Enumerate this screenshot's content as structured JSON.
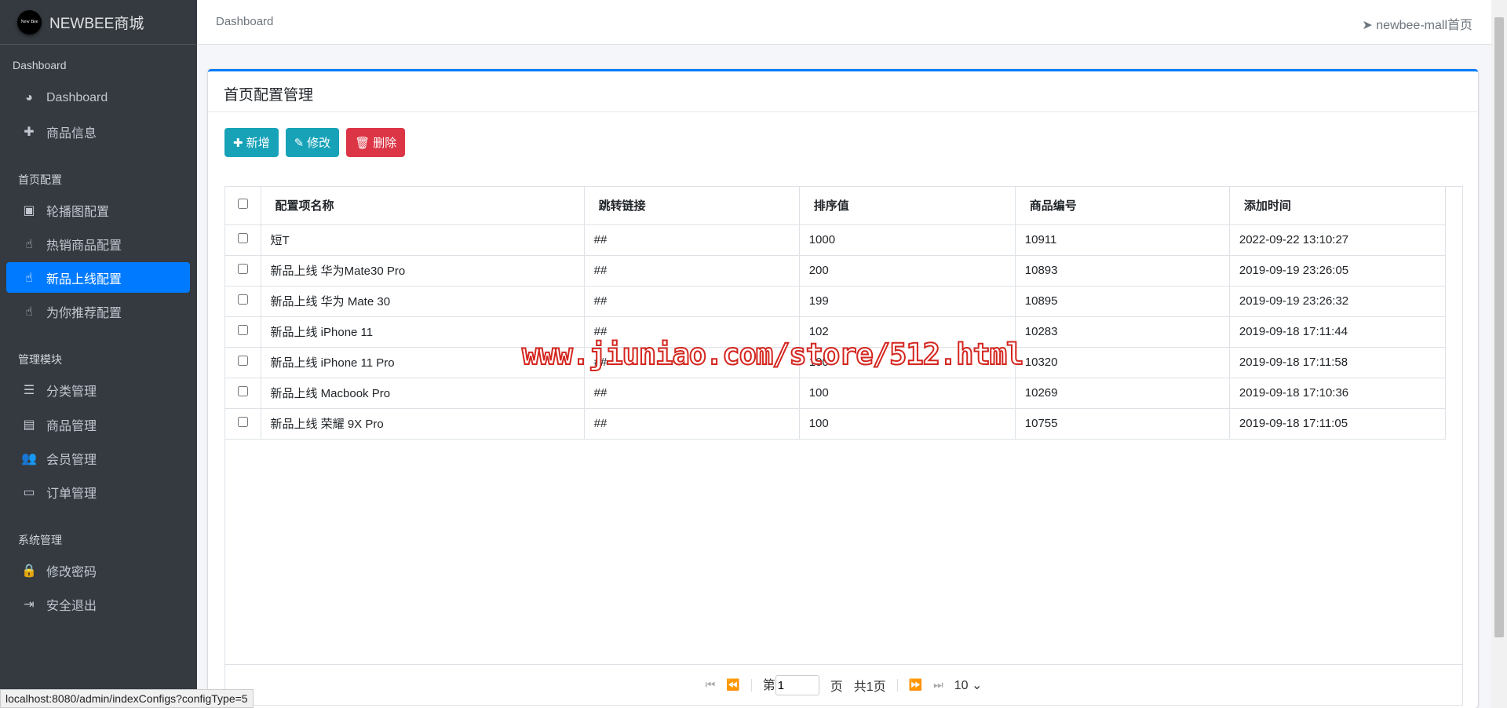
{
  "brand": {
    "logo_text": "New Bee",
    "name": "NEWBEE商城"
  },
  "sidebar": {
    "sections": [
      {
        "title": "Dashboard",
        "items": [
          {
            "label": "Dashboard",
            "icon": "tachometer-icon"
          },
          {
            "label": "商品信息",
            "icon": "plus-icon"
          }
        ]
      },
      {
        "title": "首页配置",
        "items": [
          {
            "label": "轮播图配置",
            "icon": "image-icon"
          },
          {
            "label": "热销商品配置",
            "icon": "hand-pointer-icon"
          },
          {
            "label": "新品上线配置",
            "icon": "hand-pointer-icon",
            "active": true
          },
          {
            "label": "为你推荐配置",
            "icon": "hand-pointer-icon"
          }
        ]
      },
      {
        "title": "管理模块",
        "items": [
          {
            "label": "分类管理",
            "icon": "list-icon"
          },
          {
            "label": "商品管理",
            "icon": "archive-icon"
          },
          {
            "label": "会员管理",
            "icon": "users-icon"
          },
          {
            "label": "订单管理",
            "icon": "money-icon"
          }
        ]
      },
      {
        "title": "系统管理",
        "items": [
          {
            "label": "修改密码",
            "icon": "lock-icon"
          },
          {
            "label": "安全退出",
            "icon": "sign-out-icon"
          }
        ]
      }
    ]
  },
  "header": {
    "breadcrumb": "Dashboard",
    "home_link": "newbee-mall首页"
  },
  "card": {
    "title": "首页配置管理",
    "buttons": {
      "add": "新增",
      "edit": "修改",
      "delete": "删除"
    }
  },
  "table": {
    "columns": [
      "配置项名称",
      "跳转链接",
      "排序值",
      "商品编号",
      "添加时间"
    ],
    "rows": [
      [
        "短T",
        "##",
        "1000",
        "10911",
        "2022-09-22 13:10:27"
      ],
      [
        "新品上线 华为Mate30 Pro",
        "##",
        "200",
        "10893",
        "2019-09-19 23:26:05"
      ],
      [
        "新品上线 华为 Mate 30",
        "##",
        "199",
        "10895",
        "2019-09-19 23:26:32"
      ],
      [
        "新品上线 iPhone 11",
        "##",
        "102",
        "10283",
        "2019-09-18 17:11:44"
      ],
      [
        "新品上线 iPhone 11 Pro",
        "##",
        "100",
        "10320",
        "2019-09-18 17:11:58"
      ],
      [
        "新品上线 Macbook Pro",
        "##",
        "100",
        "10269",
        "2019-09-18 17:10:36"
      ],
      [
        "新品上线 荣耀 9X Pro",
        "##",
        "100",
        "10755",
        "2019-09-18 17:11:05"
      ]
    ]
  },
  "pager": {
    "prefix": "第",
    "page": "1",
    "suffix": "页",
    "total": "共1页",
    "page_size": "10"
  },
  "watermark": "www.jiuniao.com/store/512.html",
  "status_url": "localhost:8080/admin/indexConfigs?configType=5"
}
